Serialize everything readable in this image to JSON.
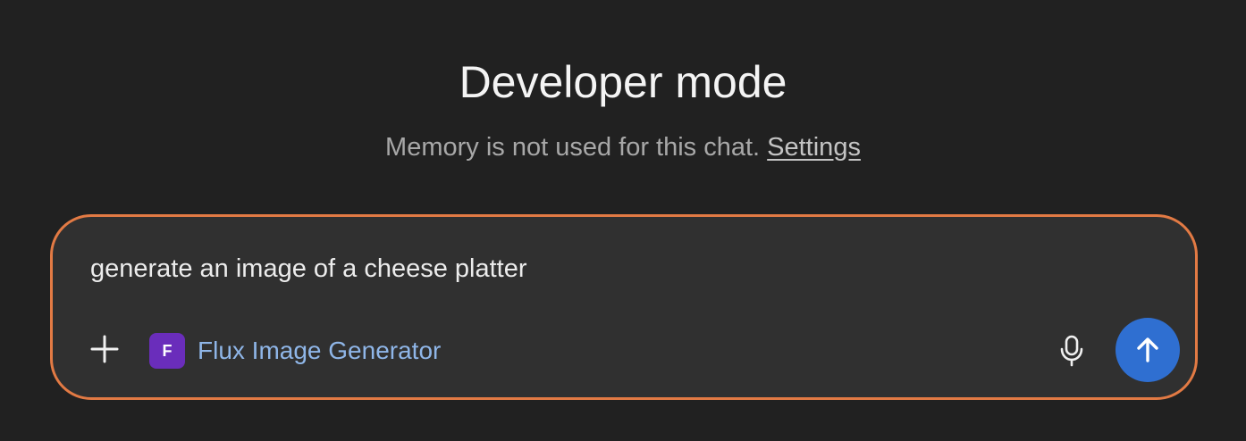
{
  "header": {
    "title": "Developer mode",
    "memory_notice": "Memory is not used for this chat.",
    "settings_link": "Settings"
  },
  "composer": {
    "input_value": "generate an image of a cheese platter",
    "attach_icon": "plus-icon",
    "tool": {
      "avatar_letter": "F",
      "avatar_color": "#6a2dbb",
      "label": "Flux Image Generator"
    },
    "mic_icon": "microphone-icon",
    "send_icon": "arrow-up-icon",
    "border_color": "#e27a44",
    "send_color": "#2f6fd1"
  }
}
